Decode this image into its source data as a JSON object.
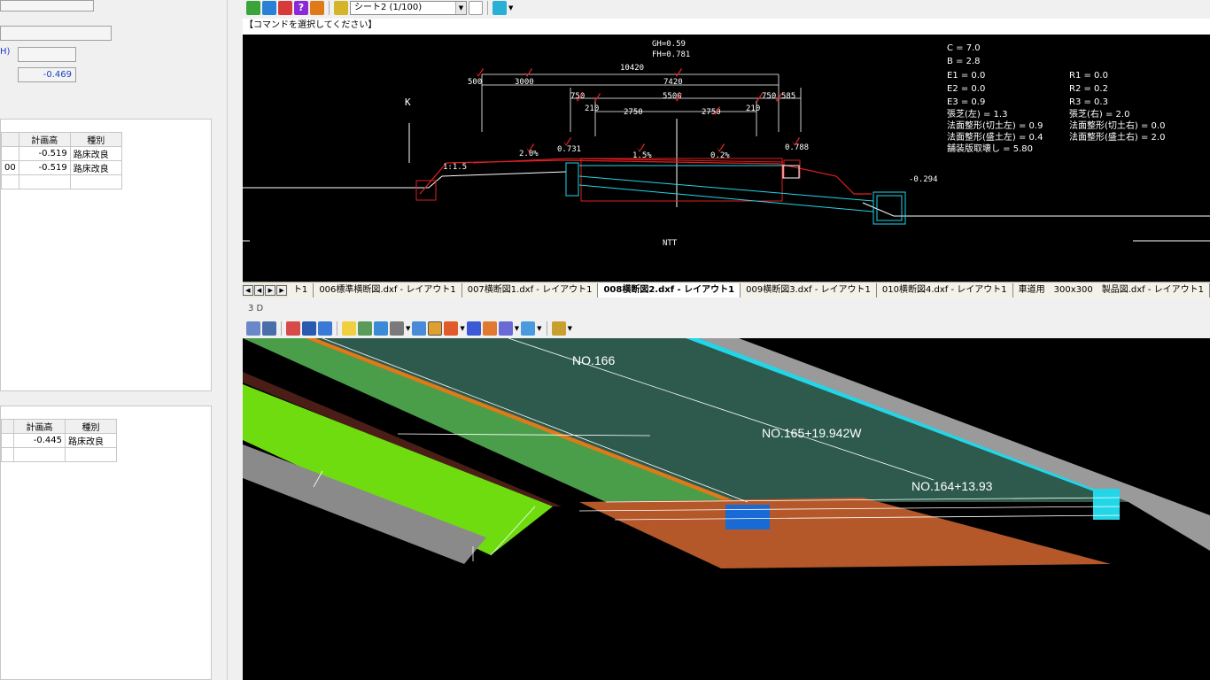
{
  "left_panel": {
    "unit_label_h": "H)",
    "value_field": "-0.469",
    "table1": {
      "headers": [
        "",
        "計画高",
        "種別"
      ],
      "rows": [
        [
          "",
          "-0.519",
          "路床改良"
        ],
        [
          "00",
          "-0.519",
          "路床改良"
        ],
        [
          "",
          "",
          ""
        ]
      ]
    },
    "table2": {
      "headers": [
        "",
        "計画高",
        "種別"
      ],
      "rows": [
        [
          "",
          "-0.445",
          "路床改良"
        ],
        [
          "",
          "",
          ""
        ]
      ]
    }
  },
  "toolbar": {
    "sheet_select": "シート2 (1/100)"
  },
  "command_line": "【コマンドを選択してください】",
  "cad_view": {
    "top_labels": [
      "GH=0.59",
      "FH=0.781"
    ],
    "dimensions": [
      "10420",
      "7420",
      "500",
      "3000",
      "750",
      "5500",
      "750",
      "585",
      "210",
      "2750",
      "2750",
      "210"
    ],
    "marker_k": "K",
    "slope_labels": [
      "2.0%",
      "1.5%",
      "0.2%",
      "1:1.5"
    ],
    "point_labels": [
      "0.731",
      "0.788",
      "-0.294"
    ],
    "ntt_label": "NTT",
    "params_left": [
      "C = 7.0",
      "B = 2.8",
      "E1 = 0.0",
      "E2 = 0.0",
      "E3 = 0.9",
      "張芝(左) = 1.3",
      "法面整形(切土左) = 0.9",
      "法面整形(盛土左) = 0.4",
      "舗装版取壊し = 5.80"
    ],
    "params_right": [
      "R1 = 0.0",
      "R2 = 0.2",
      "R3 = 0.3",
      "張芝(右) = 2.0",
      "法面整形(切土右) = 0.0",
      "法面整形(盛土右) = 2.0"
    ]
  },
  "tabs": [
    "ト1",
    "006標準横断図.dxf - レイアウト1",
    "007横断図1.dxf - レイアウト1",
    "008横断図2.dxf - レイアウト1",
    "009横断図3.dxf - レイアウト1",
    "010横断図4.dxf - レイアウト1",
    "車道用　300x300　製品図.dxf - レイアウト1"
  ],
  "active_tab_index": 3,
  "pane3d": {
    "title": "3 D",
    "labels": [
      "NO.166",
      "NO.165+19.942W",
      "NO.164+13.93"
    ]
  },
  "colors": {
    "cad_bg": "#000000",
    "road_surface": "#2e5a4e",
    "grass_green": "#6fdc10",
    "shoulder_orange": "#e07a18",
    "soil_brown": "#b4582a",
    "gutter_cyan": "#22d6e8",
    "dim_red": "#e02020"
  }
}
